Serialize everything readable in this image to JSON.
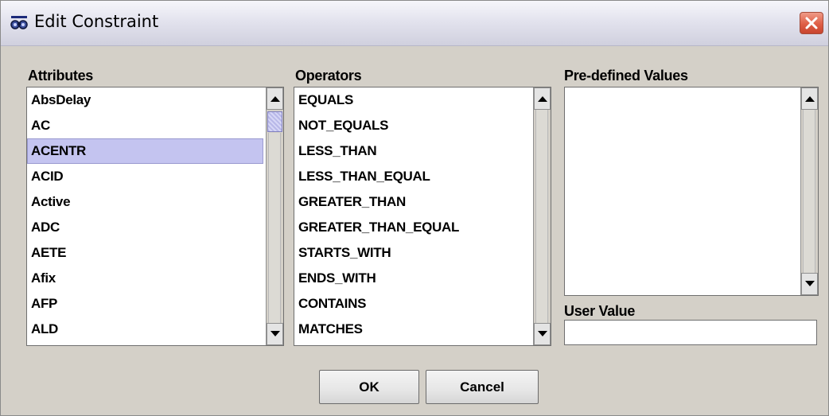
{
  "window": {
    "title": "Edit Constraint"
  },
  "attributes": {
    "label": "Attributes",
    "items": [
      "AbsDelay",
      "AC",
      "ACENTR",
      "ACID",
      "Active",
      "ADC",
      "AETE",
      "Afix",
      "AFP",
      "ALD"
    ],
    "selected": "ACENTR"
  },
  "operators": {
    "label": "Operators",
    "items": [
      "EQUALS",
      "NOT_EQUALS",
      "LESS_THAN",
      "LESS_THAN_EQUAL",
      "GREATER_THAN",
      "GREATER_THAN_EQUAL",
      "STARTS_WITH",
      "ENDS_WITH",
      "CONTAINS",
      "MATCHES"
    ]
  },
  "predefined": {
    "label": "Pre-defined Values",
    "items": []
  },
  "user_value": {
    "label": "User Value",
    "value": ""
  },
  "buttons": {
    "ok": "OK",
    "cancel": "Cancel"
  },
  "colors": {
    "dialog_bg": "#d4d0c8",
    "selection_bg": "#c4c4f0",
    "close_button": "#df5f46"
  },
  "icons": {
    "title": "binoculars-icon",
    "close": "close-icon"
  }
}
